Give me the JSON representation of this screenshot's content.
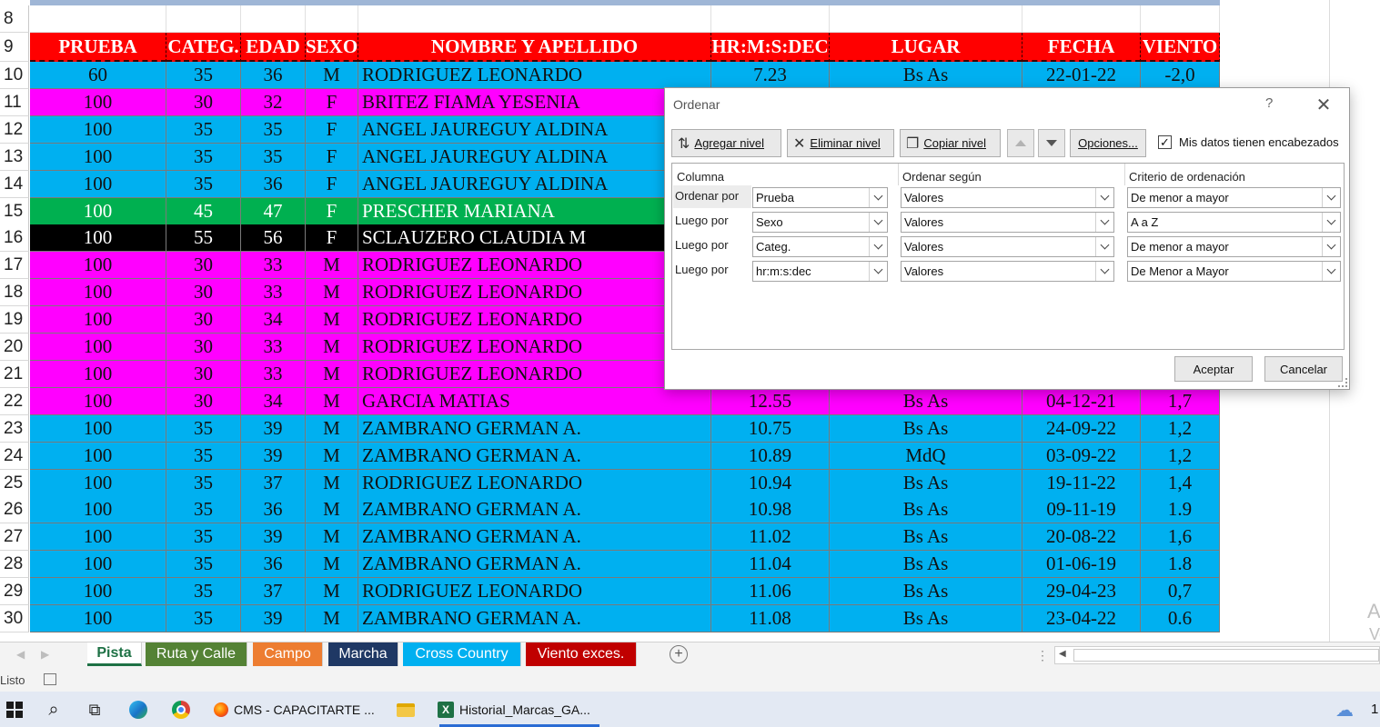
{
  "sheet": {
    "row_numbers": [
      "8",
      "9",
      "10",
      "11",
      "12",
      "13",
      "14",
      "15",
      "16",
      "17",
      "18",
      "19",
      "20",
      "21",
      "22",
      "23",
      "24",
      "25",
      "26",
      "27",
      "28",
      "29",
      "30"
    ],
    "headers": [
      "PRUEBA",
      "CATEG.",
      "EDAD",
      "SEXO",
      "NOMBRE Y APELLIDO",
      "HR:M:S:DEC",
      "LUGAR",
      "FECHA",
      "VIENTO"
    ],
    "rows": [
      {
        "color": "#00b0f0",
        "text": "#111111",
        "cells": [
          "60",
          "35",
          "36",
          "M",
          "RODRIGUEZ LEONARDO",
          "7.23",
          "Bs As",
          "22-01-22",
          "-2,0"
        ]
      },
      {
        "color": "#ff00ff",
        "text": "#111111",
        "cells": [
          "100",
          "30",
          "32",
          "F",
          "BRITEZ FIAMA YESENIA",
          "",
          "",
          "",
          ""
        ]
      },
      {
        "color": "#00b0f0",
        "text": "#111111",
        "cells": [
          "100",
          "35",
          "35",
          "F",
          "ANGEL JAUREGUY   ALDINA",
          "",
          "",
          "",
          ""
        ]
      },
      {
        "color": "#00b0f0",
        "text": "#111111",
        "cells": [
          "100",
          "35",
          "35",
          "F",
          "ANGEL JAUREGUY  ALDINA",
          "",
          "",
          "",
          ""
        ]
      },
      {
        "color": "#00b0f0",
        "text": "#111111",
        "cells": [
          "100",
          "35",
          "36",
          "F",
          "ANGEL JAUREGUY ALDINA",
          "",
          "",
          "",
          ""
        ]
      },
      {
        "color": "#00b050",
        "text": "#ffffff",
        "cells": [
          "100",
          "45",
          "47",
          "F",
          "PRESCHER MARIANA",
          "",
          "",
          "",
          ""
        ]
      },
      {
        "color": "#000000",
        "text": "#ffffff",
        "cells": [
          "100",
          "55",
          "56",
          "F",
          "SCLAUZERO  CLAUDIA M",
          "",
          "",
          "",
          ""
        ]
      },
      {
        "color": "#ff00ff",
        "text": "#111111",
        "cells": [
          "100",
          "30",
          "33",
          "M",
          "RODRIGUEZ  LEONARDO",
          "",
          "",
          "",
          ""
        ]
      },
      {
        "color": "#ff00ff",
        "text": "#111111",
        "cells": [
          "100",
          "30",
          "33",
          "M",
          "RODRIGUEZ  LEONARDO",
          "",
          "",
          "",
          ""
        ]
      },
      {
        "color": "#ff00ff",
        "text": "#111111",
        "cells": [
          "100",
          "30",
          "34",
          "M",
          "RODRIGUEZ  LEONARDO",
          "",
          "",
          "",
          ""
        ]
      },
      {
        "color": "#ff00ff",
        "text": "#111111",
        "cells": [
          "100",
          "30",
          "33",
          "M",
          "RODRIGUEZ  LEONARDO",
          "",
          "",
          "",
          ""
        ]
      },
      {
        "color": "#ff00ff",
        "text": "#111111",
        "cells": [
          "100",
          "30",
          "33",
          "M",
          "RODRIGUEZ  LEONARDO",
          "",
          "",
          "",
          ""
        ]
      },
      {
        "color": "#ff00ff",
        "text": "#111111",
        "cells": [
          "100",
          "30",
          "34",
          "M",
          "GARCIA   MATIAS",
          "12.55",
          "Bs As",
          "04-12-21",
          "1,7"
        ]
      },
      {
        "color": "#00b0f0",
        "text": "#111111",
        "cells": [
          "100",
          "35",
          "39",
          "M",
          "ZAMBRANO  GERMAN A.",
          "10.75",
          "Bs As",
          "24-09-22",
          "1,2"
        ]
      },
      {
        "color": "#00b0f0",
        "text": "#111111",
        "cells": [
          "100",
          "35",
          "39",
          "M",
          "ZAMBRANO  GERMAN A.",
          "10.89",
          "MdQ",
          "03-09-22",
          "1,2"
        ]
      },
      {
        "color": "#00b0f0",
        "text": "#111111",
        "cells": [
          "100",
          "35",
          "37",
          "M",
          "RODRIGUEZ LEONARDO",
          "10.94",
          "Bs As",
          "19-11-22",
          "1,4"
        ]
      },
      {
        "color": "#00b0f0",
        "text": "#111111",
        "cells": [
          "100",
          "35",
          "36",
          "M",
          "ZAMBRANO  GERMAN A.",
          "10.98",
          "Bs As",
          "09-11-19",
          "1.9"
        ]
      },
      {
        "color": "#00b0f0",
        "text": "#111111",
        "cells": [
          "100",
          "35",
          "39",
          "M",
          "ZAMBRANO  GERMAN A.",
          "11.02",
          "Bs As",
          "20-08-22",
          "1,6"
        ]
      },
      {
        "color": "#00b0f0",
        "text": "#111111",
        "cells": [
          "100",
          "35",
          "36",
          "M",
          "ZAMBRANO  GERMAN A.",
          "11.04",
          "Bs As",
          "01-06-19",
          "1.8"
        ]
      },
      {
        "color": "#00b0f0",
        "text": "#111111",
        "cells": [
          "100",
          "35",
          "37",
          "M",
          "RODRIGUEZ LEONARDO",
          "11.06",
          "Bs As",
          "29-04-23",
          "0,7"
        ]
      },
      {
        "color": "#00b0f0",
        "text": "#111111",
        "cells": [
          "100",
          "35",
          "39",
          "M",
          "ZAMBRANO  GERMAN A.",
          "11.08",
          "Bs As",
          "23-04-22",
          "0.6"
        ]
      }
    ],
    "ghost_right": [
      "A",
      "Ve"
    ]
  },
  "dialog": {
    "title": "Ordenar",
    "help": "?",
    "close": "✕",
    "toolbar": {
      "add_level": "Agregar nivel",
      "delete_level": "Eliminar nivel",
      "copy_level": "Copiar nivel",
      "options": "Opciones...",
      "has_headers": "Mis datos tienen encabezados",
      "has_headers_checked": true
    },
    "columns": {
      "column": "Columna",
      "sort_on": "Ordenar según",
      "order": "Criterio de ordenación"
    },
    "levels": [
      {
        "label": "Ordenar por",
        "column": "Prueba",
        "sort_on": "Valores",
        "order": "De menor a mayor"
      },
      {
        "label": "Luego por",
        "column": "Sexo",
        "sort_on": "Valores",
        "order": "A a Z"
      },
      {
        "label": "Luego por",
        "column": "Categ.",
        "sort_on": "Valores",
        "order": "De menor a mayor"
      },
      {
        "label": "Luego por",
        "column": "hr:m:s:dec",
        "sort_on": "Valores",
        "order": "De Menor a Mayor"
      }
    ],
    "ok": "Aceptar",
    "cancel": "Cancelar"
  },
  "tabs": [
    {
      "label": "Pista",
      "color": "#ffffff",
      "active": true
    },
    {
      "label": "Ruta y Calle",
      "color": "#548235",
      "active": false
    },
    {
      "label": "Campo",
      "color": "#ed7d31",
      "active": false
    },
    {
      "label": "Marcha",
      "color": "#1f3864",
      "active": false
    },
    {
      "label": "Cross Country",
      "color": "#00b0f0",
      "active": false
    },
    {
      "label": "Viento exces.",
      "color": "#c00000",
      "active": false
    }
  ],
  "status": {
    "ready": "Listo"
  },
  "taskbar": {
    "apps": [
      {
        "label": "CMS - CAPACITARTE ...",
        "icon": "firefox-icon"
      },
      {
        "label": "Historial_Marcas_GA...",
        "icon": "excel-icon"
      }
    ],
    "tray_text": "1"
  }
}
